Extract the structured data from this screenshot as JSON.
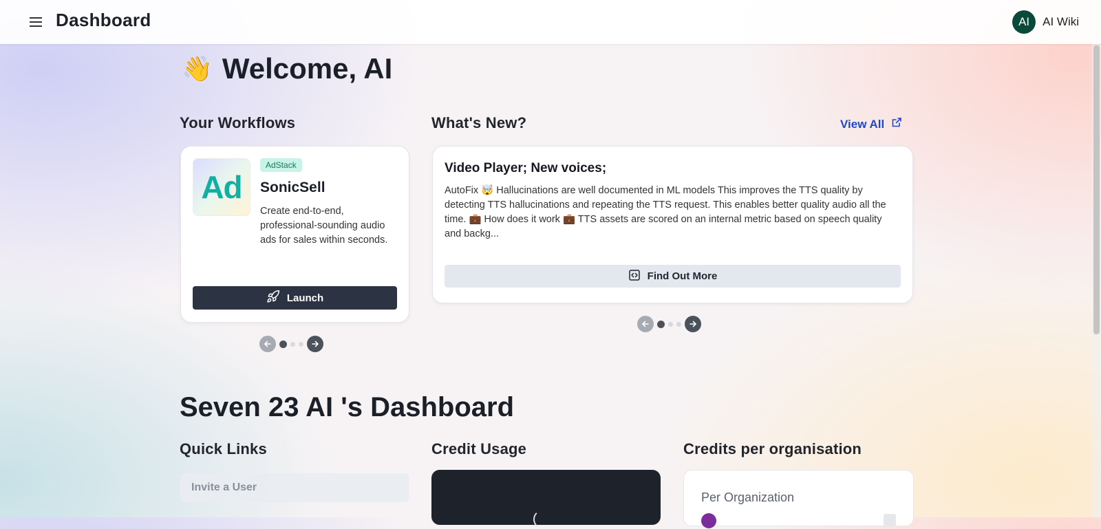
{
  "header": {
    "title": "Dashboard",
    "avatar_initials": "AI",
    "user_name": "AI Wiki"
  },
  "welcome": {
    "emoji": "👋",
    "text": "Welcome, AI"
  },
  "workflows": {
    "heading": "Your Workflows",
    "card": {
      "logo_text": "Ad",
      "badge": "AdStack",
      "name": "SonicSell",
      "description": "Create end-to-end, professional-sounding audio ads for sales within seconds.",
      "launch_label": "Launch"
    },
    "carousel": {
      "pages": 3,
      "active": 0
    }
  },
  "whats_new": {
    "heading": "What's New?",
    "view_all": "View All",
    "card": {
      "title": "Video Player; New voices;",
      "body": "AutoFix 🤯 Hallucinations are well documented in ML models This improves the TTS quality by detecting TTS hallucinations and repeating the TTS request. This enables better quality audio all the time. 💼 How does it work 💼 TTS assets are scored on an internal metric based on speech quality and backg...",
      "button_label": "Find Out More"
    },
    "carousel": {
      "pages": 3,
      "active": 0
    }
  },
  "dashboard": {
    "title": "Seven 23 AI 's Dashboard",
    "quick_links": {
      "heading": "Quick Links",
      "invite_label": "Invite a User"
    },
    "credit_usage": {
      "heading": "Credit Usage"
    },
    "credits_per_org": {
      "heading": "Credits per organisation",
      "label": "Per Organization"
    }
  },
  "colors": {
    "primary_dark": "#2c3342",
    "link_blue": "#1f48c8",
    "avatar_green": "#0b4a3a",
    "badge_green": "#c9f3e6"
  }
}
